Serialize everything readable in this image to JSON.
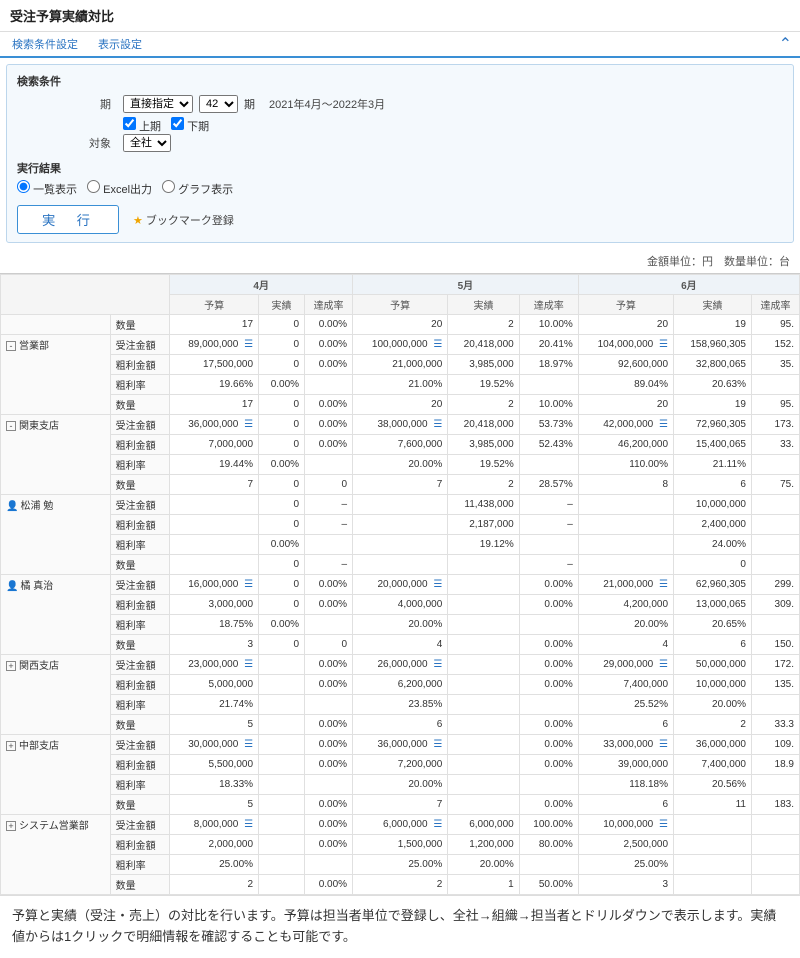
{
  "title": "受注予算実績対比",
  "tabs": {
    "search": "検索条件設定",
    "display": "表示設定"
  },
  "search": {
    "heading": "検索条件",
    "period_label": "期",
    "period_select1": "直接指定",
    "period_select2": "42",
    "period_suffix": "期",
    "period_range": "2021年4月～2022年3月",
    "first_half": "上期",
    "second_half": "下期",
    "target_label": "対象",
    "target_value": "全社",
    "results_heading": "実行結果",
    "radio_list": "一覧表示",
    "radio_excel": "Excel出力",
    "radio_graph": "グラフ表示",
    "exec_btn": "実　行",
    "bookmark": "ブックマーク登録"
  },
  "units": "金額単位：円　数量単位：台",
  "months": [
    "4月",
    "5月",
    "6月"
  ],
  "cols": [
    "予算",
    "実績",
    "達成率"
  ],
  "row_labels": {
    "suryo": "数量",
    "juchu": "受注金額",
    "arari": "粗利金額",
    "arariritsu": "粗利率"
  },
  "top_row": {
    "suryo": {
      "m4": [
        "17",
        "0",
        "0.00%"
      ],
      "m5": [
        "20",
        "2",
        "10.00%"
      ],
      "m6": [
        "20",
        "19",
        "95."
      ]
    }
  },
  "groups": [
    {
      "name": "営業部",
      "type": "org",
      "exp": "-",
      "rows": {
        "juchu": {
          "m4": [
            "89,000,000",
            "0",
            "0.00%"
          ],
          "m5": [
            "100,000,000",
            "20,418,000",
            "20.41%"
          ],
          "m6": [
            "104,000,000",
            "158,960,305",
            "152."
          ]
        },
        "arari": {
          "m4": [
            "17,500,000",
            "0",
            "0.00%"
          ],
          "m5": [
            "21,000,000",
            "3,985,000",
            "18.97%"
          ],
          "m6": [
            "92,600,000",
            "32,800,065",
            "35."
          ]
        },
        "arariritsu": {
          "m4": [
            "19.66%",
            "0.00%",
            ""
          ],
          "m5": [
            "21.00%",
            "19.52%",
            ""
          ],
          "m6": [
            "89.04%",
            "20.63%",
            ""
          ]
        },
        "suryo": {
          "m4": [
            "17",
            "0",
            "0.00%"
          ],
          "m5": [
            "20",
            "2",
            "10.00%"
          ],
          "m6": [
            "20",
            "19",
            "95."
          ]
        }
      }
    },
    {
      "name": "関東支店",
      "type": "org",
      "exp": "-",
      "rows": {
        "juchu": {
          "m4": [
            "36,000,000",
            "0",
            "0.00%"
          ],
          "m5": [
            "38,000,000",
            "20,418,000",
            "53.73%"
          ],
          "m6": [
            "42,000,000",
            "72,960,305",
            "173."
          ]
        },
        "arari": {
          "m4": [
            "7,000,000",
            "0",
            "0.00%"
          ],
          "m5": [
            "7,600,000",
            "3,985,000",
            "52.43%"
          ],
          "m6": [
            "46,200,000",
            "15,400,065",
            "33."
          ]
        },
        "arariritsu": {
          "m4": [
            "19.44%",
            "0.00%",
            ""
          ],
          "m5": [
            "20.00%",
            "19.52%",
            ""
          ],
          "m6": [
            "110.00%",
            "21.11%",
            ""
          ]
        },
        "suryo": {
          "m4": [
            "7",
            "0",
            "0"
          ],
          "m5": [
            "7",
            "2",
            "28.57%"
          ],
          "m6": [
            "8",
            "6",
            "75."
          ]
        }
      }
    },
    {
      "name": "松浦 勉",
      "type": "person",
      "rows": {
        "juchu": {
          "m4": [
            "",
            "0",
            "–"
          ],
          "m5": [
            "",
            "11,438,000",
            "–"
          ],
          "m6": [
            "",
            "10,000,000",
            ""
          ]
        },
        "arari": {
          "m4": [
            "",
            "0",
            "–"
          ],
          "m5": [
            "",
            "2,187,000",
            "–"
          ],
          "m6": [
            "",
            "2,400,000",
            ""
          ]
        },
        "arariritsu": {
          "m4": [
            "",
            "0.00%",
            ""
          ],
          "m5": [
            "",
            "19.12%",
            ""
          ],
          "m6": [
            "",
            "24.00%",
            ""
          ]
        },
        "suryo": {
          "m4": [
            "",
            "0",
            "–"
          ],
          "m5": [
            "",
            "",
            "–"
          ],
          "m6": [
            "",
            "0",
            ""
          ]
        }
      }
    },
    {
      "name": "橘 真治",
      "type": "person",
      "rows": {
        "juchu": {
          "m4": [
            "16,000,000",
            "0",
            "0.00%"
          ],
          "m5": [
            "20,000,000",
            "",
            "0.00%"
          ],
          "m6": [
            "21,000,000",
            "62,960,305",
            "299."
          ]
        },
        "arari": {
          "m4": [
            "3,000,000",
            "0",
            "0.00%"
          ],
          "m5": [
            "4,000,000",
            "",
            "0.00%"
          ],
          "m6": [
            "4,200,000",
            "13,000,065",
            "309."
          ]
        },
        "arariritsu": {
          "m4": [
            "18.75%",
            "0.00%",
            ""
          ],
          "m5": [
            "20.00%",
            "",
            ""
          ],
          "m6": [
            "20.00%",
            "20.65%",
            ""
          ]
        },
        "suryo": {
          "m4": [
            "3",
            "0",
            "0"
          ],
          "m5": [
            "4",
            "",
            "0.00%"
          ],
          "m6": [
            "4",
            "6",
            "150."
          ]
        }
      }
    },
    {
      "name": "関西支店",
      "type": "org",
      "exp": "+",
      "rows": {
        "juchu": {
          "m4": [
            "23,000,000",
            "",
            "0.00%"
          ],
          "m5": [
            "26,000,000",
            "",
            "0.00%"
          ],
          "m6": [
            "29,000,000",
            "50,000,000",
            "172."
          ]
        },
        "arari": {
          "m4": [
            "5,000,000",
            "",
            "0.00%"
          ],
          "m5": [
            "6,200,000",
            "",
            "0.00%"
          ],
          "m6": [
            "7,400,000",
            "10,000,000",
            "135."
          ]
        },
        "arariritsu": {
          "m4": [
            "21.74%",
            "",
            ""
          ],
          "m5": [
            "23.85%",
            "",
            ""
          ],
          "m6": [
            "25.52%",
            "20.00%",
            ""
          ]
        },
        "suryo": {
          "m4": [
            "5",
            "",
            "0.00%"
          ],
          "m5": [
            "6",
            "",
            "0.00%"
          ],
          "m6": [
            "6",
            "2",
            "33.3"
          ]
        }
      }
    },
    {
      "name": "中部支店",
      "type": "org",
      "exp": "+",
      "rows": {
        "juchu": {
          "m4": [
            "30,000,000",
            "",
            "0.00%"
          ],
          "m5": [
            "36,000,000",
            "",
            "0.00%"
          ],
          "m6": [
            "33,000,000",
            "36,000,000",
            "109."
          ]
        },
        "arari": {
          "m4": [
            "5,500,000",
            "",
            "0.00%"
          ],
          "m5": [
            "7,200,000",
            "",
            "0.00%"
          ],
          "m6": [
            "39,000,000",
            "7,400,000",
            "18.9"
          ]
        },
        "arariritsu": {
          "m4": [
            "18.33%",
            "",
            ""
          ],
          "m5": [
            "20.00%",
            "",
            ""
          ],
          "m6": [
            "118.18%",
            "20.56%",
            ""
          ]
        },
        "suryo": {
          "m4": [
            "5",
            "",
            "0.00%"
          ],
          "m5": [
            "7",
            "",
            "0.00%"
          ],
          "m6": [
            "6",
            "11",
            "183."
          ]
        }
      }
    },
    {
      "name": "システム営業部",
      "type": "org",
      "exp": "+",
      "rows": {
        "juchu": {
          "m4": [
            "8,000,000",
            "",
            "0.00%"
          ],
          "m5": [
            "6,000,000",
            "6,000,000",
            "100.00%"
          ],
          "m6": [
            "10,000,000",
            "",
            ""
          ]
        },
        "arari": {
          "m4": [
            "2,000,000",
            "",
            "0.00%"
          ],
          "m5": [
            "1,500,000",
            "1,200,000",
            "80.00%"
          ],
          "m6": [
            "2,500,000",
            "",
            ""
          ]
        },
        "arariritsu": {
          "m4": [
            "25.00%",
            "",
            ""
          ],
          "m5": [
            "25.00%",
            "20.00%",
            ""
          ],
          "m6": [
            "25.00%",
            "",
            ""
          ]
        },
        "suryo": {
          "m4": [
            "2",
            "",
            "0.00%"
          ],
          "m5": [
            "2",
            "1",
            "50.00%"
          ],
          "m6": [
            "3",
            "",
            ""
          ]
        }
      }
    }
  ],
  "description": "予算と実績（受注・売上）の対比を行います。予算は担当者単位で登録し、全社→組織→担当者とドリルダウンで表示します。実績値からは1クリックで明細情報を確認することも可能です。"
}
